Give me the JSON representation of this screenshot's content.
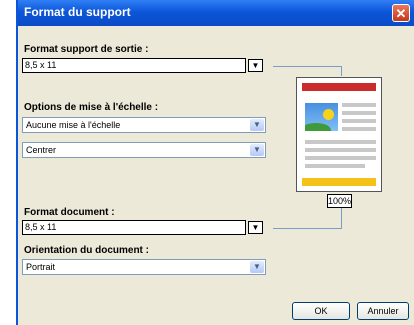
{
  "window": {
    "title": "Format du support",
    "close_icon": "close-icon"
  },
  "output_format": {
    "label": "Format support de sortie :",
    "value": "8,5 x 11"
  },
  "scaling": {
    "label": "Options de mise à l'échelle :",
    "scale_value": "Aucune mise à l'échelle",
    "align_value": "Centrer"
  },
  "document_format": {
    "label": "Format document :",
    "value": "8,5 x 11"
  },
  "orientation": {
    "label": "Orientation du document :",
    "value": "Portrait"
  },
  "preview": {
    "zoom": "100%"
  },
  "buttons": {
    "ok": "OK",
    "cancel": "Annuler"
  },
  "colors": {
    "titlebar": "#0c56d8",
    "close": "#c5371a",
    "preview_header": "#cc2b2b",
    "preview_footer": "#f5c21a"
  }
}
